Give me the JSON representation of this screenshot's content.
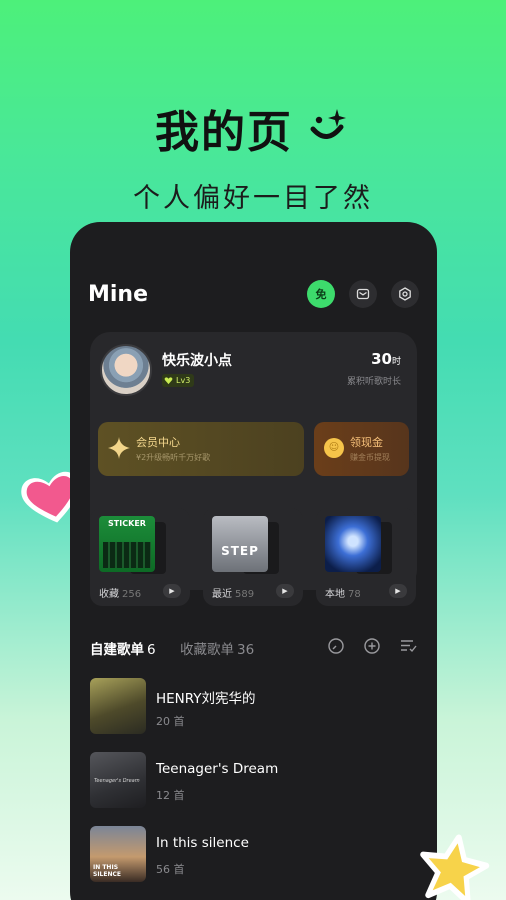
{
  "headline": {
    "title": "我的页",
    "subtitle": "个人偏好一目了然"
  },
  "header": {
    "title": "Mine",
    "free_badge": "免"
  },
  "profile": {
    "username": "快乐波小点",
    "level": "Lv3",
    "listen_hours": "30",
    "listen_unit": "时",
    "listen_label": "累积听歌时长"
  },
  "benefits": {
    "vip": {
      "title": "会员中心",
      "subtitle": "¥2升级畅听千万好歌"
    },
    "cash": {
      "title": "领现金",
      "subtitle": "赚金币提现"
    }
  },
  "tiles": [
    {
      "label": "收藏",
      "count": "256",
      "cover_text": "STICKER"
    },
    {
      "label": "最近",
      "count": "589",
      "cover_text": "STEP"
    },
    {
      "label": "本地",
      "count": "78",
      "cover_text": ""
    }
  ],
  "tabs": {
    "created": {
      "label": "自建歌单",
      "count": "6"
    },
    "collected": {
      "label": "收藏歌单",
      "count": "36"
    }
  },
  "songs": [
    {
      "title": "HENRY刘宪华的",
      "count": "20 首",
      "cover_text": ""
    },
    {
      "title": "Teenager's Dream",
      "count": "12 首",
      "cover_text": "Teenager's Dream"
    },
    {
      "title": "In this silence",
      "count": "56 首",
      "cover_text": "IN THIS SILENCE"
    }
  ],
  "colors": {
    "accent": "#3ddb6c",
    "card_bg": "#28282b",
    "phone_bg": "#1d1d1f"
  }
}
